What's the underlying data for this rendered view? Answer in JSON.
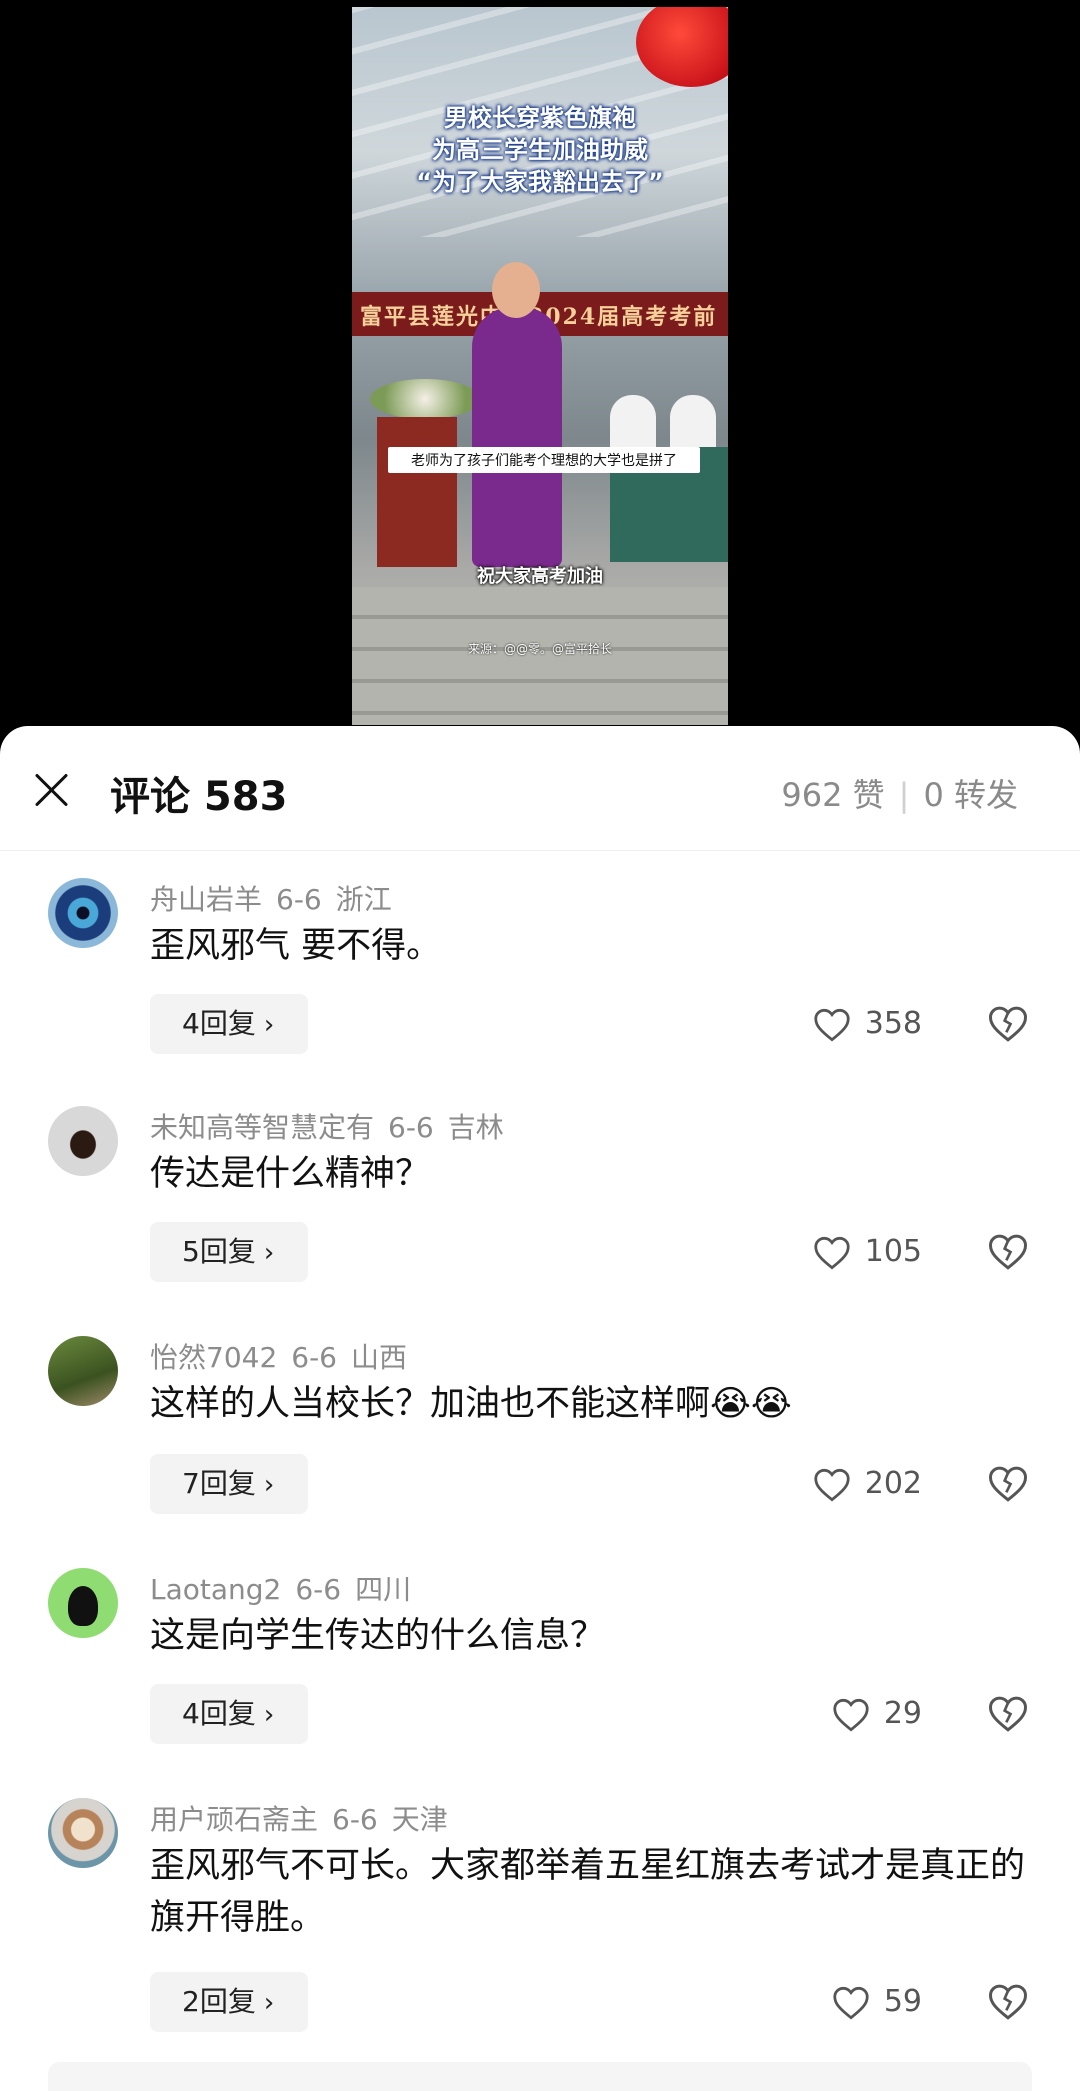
{
  "video": {
    "title_line1": "男校长穿紫色旗袍",
    "title_line2": "为高三学生加油助威",
    "title_line3": "“为了大家我豁出去了”",
    "banner": "富平县莲光中学2024届高考考前",
    "caption": "老师为了孩子们能考个理想的大学也是拼了",
    "subtitle": "祝大家高考加油",
    "source": "来源：@@零。@富平拾长"
  },
  "header": {
    "title": "评论 583",
    "likes": "962 赞",
    "separator": "|",
    "shares": "0 转发"
  },
  "comments": [
    {
      "user": "舟山岩羊",
      "date": "6-6",
      "location": "浙江",
      "text": "歪风邪气 要不得。",
      "replies": "4回复",
      "likes": "358"
    },
    {
      "user": "未知高等智慧定有",
      "date": "6-6",
      "location": "吉林",
      "text": "传达是什么精神？",
      "replies": "5回复",
      "likes": "105"
    },
    {
      "user": "怡然7042",
      "date": "6-6",
      "location": "山西",
      "text": "这样的人当校长？加油也不能这样啊😭😭",
      "replies": "7回复",
      "likes": "202"
    },
    {
      "user": "Laotang2",
      "date": "6-6",
      "location": "四川",
      "text": "这是向学生传达的什么信息？",
      "replies": "4回复",
      "likes": "29"
    },
    {
      "user": "用户顽石斋主",
      "date": "6-6",
      "location": "天津",
      "text": "歪风邪气不可长。大家都举着五星红旗去考试才是真正的旗开得胜。",
      "replies": "2回复",
      "likes": "59"
    }
  ],
  "icons": {
    "close": "close-icon",
    "like": "heart-icon",
    "dislike": "broken-heart-icon",
    "reply_chevron": "chevron-right-icon"
  }
}
